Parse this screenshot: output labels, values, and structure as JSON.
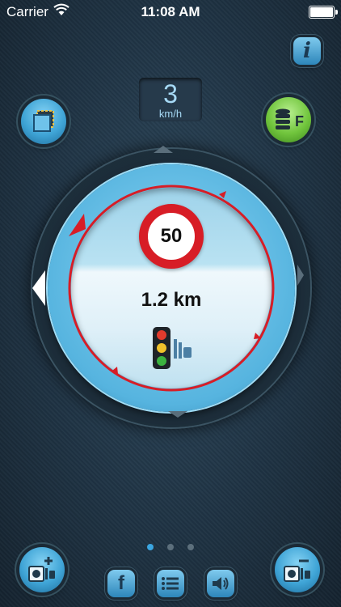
{
  "status_bar": {
    "carrier": "Carrier",
    "time": "11:08 AM"
  },
  "speed": {
    "value": "3",
    "unit": "km/h"
  },
  "radar": {
    "speed_limit": "50",
    "distance": "1.2 km"
  },
  "pager": {
    "count": 3,
    "active_index": 0
  },
  "buttons": {
    "info": "i",
    "database_letter": "F",
    "facebook": "f"
  },
  "colors": {
    "accent_blue": "#3fa4d6",
    "ring_red": "#d71d26",
    "database_green": "#71c53d",
    "background": "#1f3344"
  },
  "icons": [
    "wifi-icon",
    "battery-icon",
    "info-icon",
    "layers-icon",
    "database-icon",
    "camera-add-icon",
    "camera-remove-icon",
    "facebook-icon",
    "list-icon",
    "speaker-icon",
    "traffic-light-icon"
  ]
}
